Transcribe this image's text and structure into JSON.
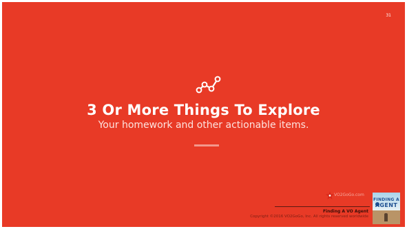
{
  "slide": {
    "page_number": "31",
    "background_color": "#e83a26",
    "section_icon": "connected-dots-icon",
    "title": "3 Or More Things To Explore",
    "subtitle": "Your homework and other actionable items.",
    "accent_color": "#f3988c"
  },
  "footer": {
    "brand_text": "VO2GoGo.com",
    "brand_icon": "star-burst-icon",
    "book_title": "Finding A VO Agent",
    "copyright": "Copyright ©2016 VO2GoGo, Inc. All rights reserved worldwide",
    "thumbnail": {
      "line1": "FINDING A",
      "line2": "AGENT"
    }
  }
}
